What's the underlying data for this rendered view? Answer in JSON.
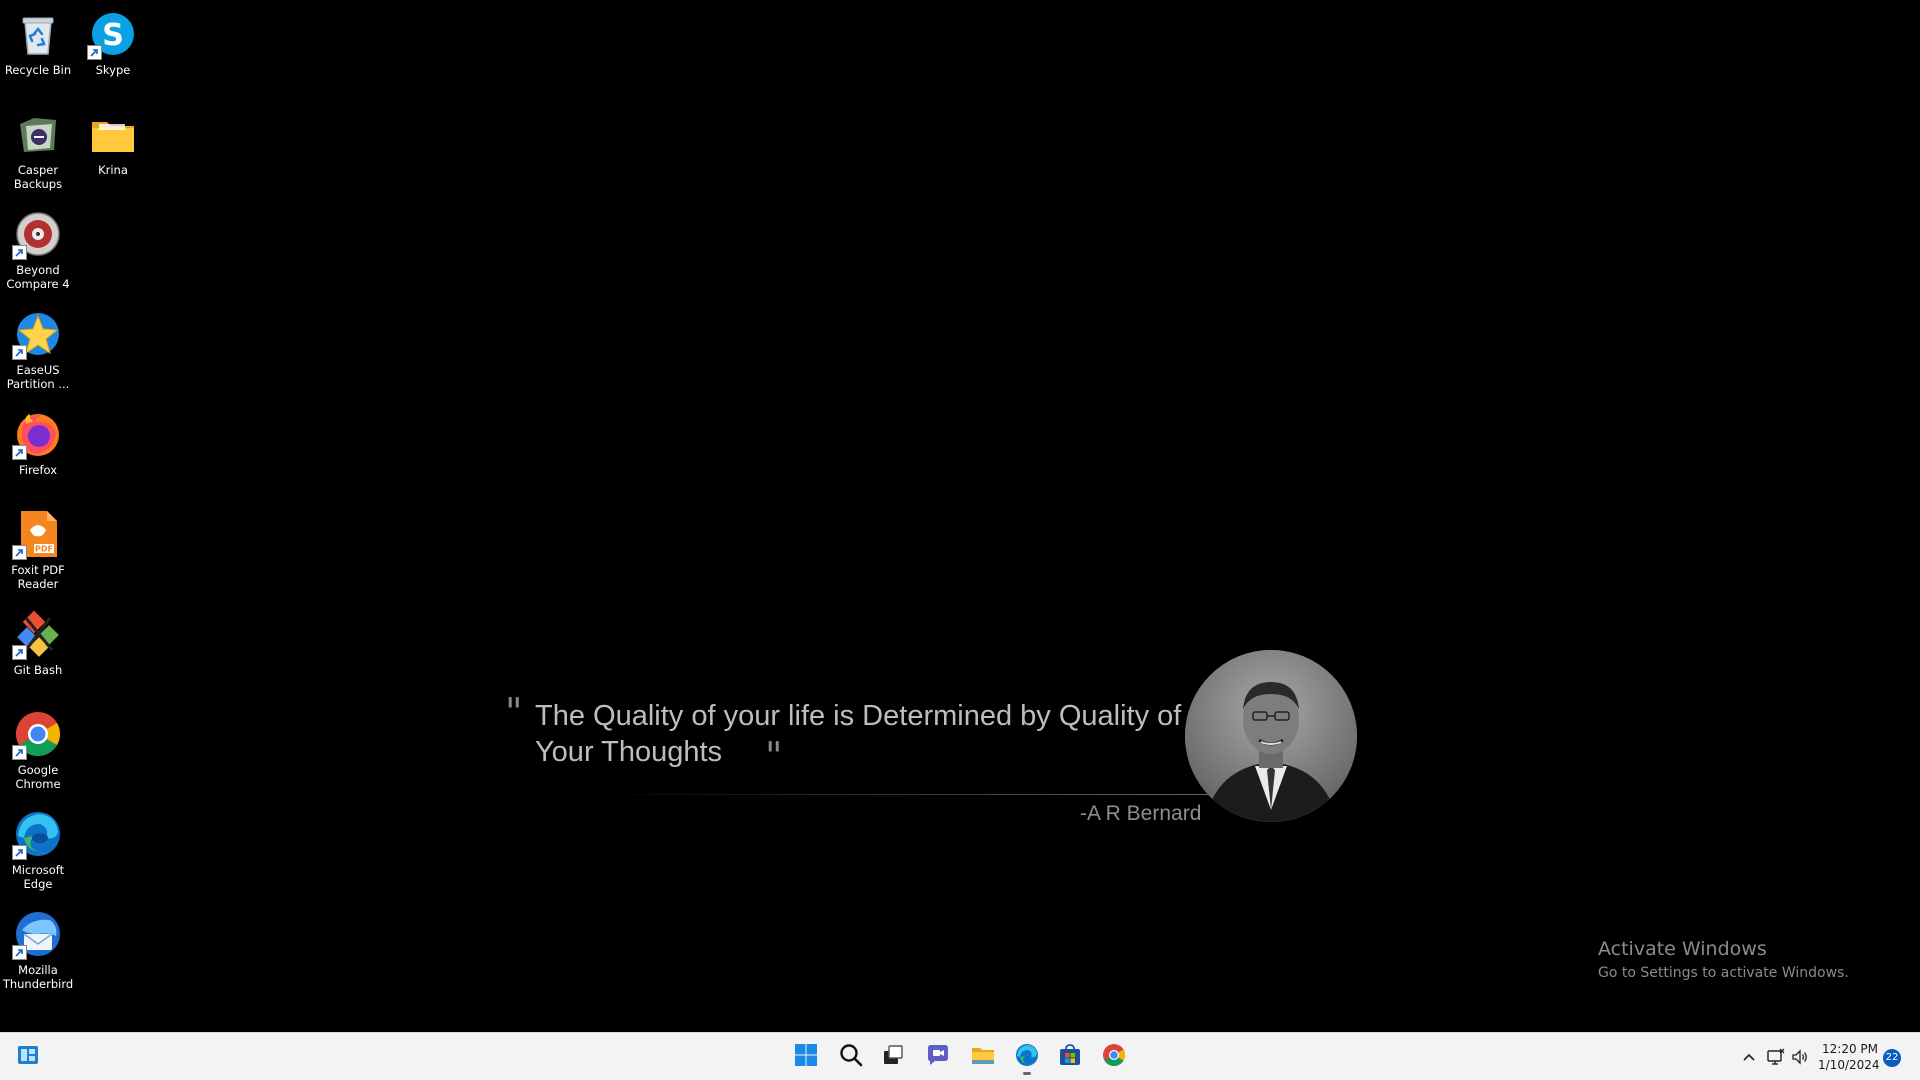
{
  "desktop_icons": [
    {
      "id": "recycle-bin",
      "label": "Recycle Bin"
    },
    {
      "id": "skype",
      "label": "Skype"
    },
    {
      "id": "casper-backups",
      "label": "Casper Backups"
    },
    {
      "id": "krina",
      "label": "Krina"
    },
    {
      "id": "beyond-compare",
      "label": "Beyond Compare 4"
    },
    {
      "id": "easeus",
      "label": "EaseUS Partition ..."
    },
    {
      "id": "firefox",
      "label": "Firefox"
    },
    {
      "id": "foxit",
      "label": "Foxit PDF Reader"
    },
    {
      "id": "git-bash",
      "label": "Git Bash"
    },
    {
      "id": "chrome",
      "label": "Google Chrome"
    },
    {
      "id": "edge",
      "label": "Microsoft Edge"
    },
    {
      "id": "thunderbird",
      "label": "Mozilla Thunderbird"
    }
  ],
  "wallpaper": {
    "quote": "The Quality of your  life is Determined by Quality of Your Thoughts",
    "author": "-A R Bernard"
  },
  "watermark": {
    "title": "Activate Windows",
    "subtitle": "Go to Settings to activate Windows."
  },
  "taskbar": {
    "apps": [
      "start-icon",
      "search-icon",
      "task-view-icon",
      "teams-chat-icon",
      "file-explorer-icon",
      "edge-icon",
      "store-icon",
      "chrome-icon"
    ],
    "active_app": "edge-icon"
  },
  "tray": {
    "time": "12:20 PM",
    "date": "1/10/2024",
    "notifications": "22"
  }
}
